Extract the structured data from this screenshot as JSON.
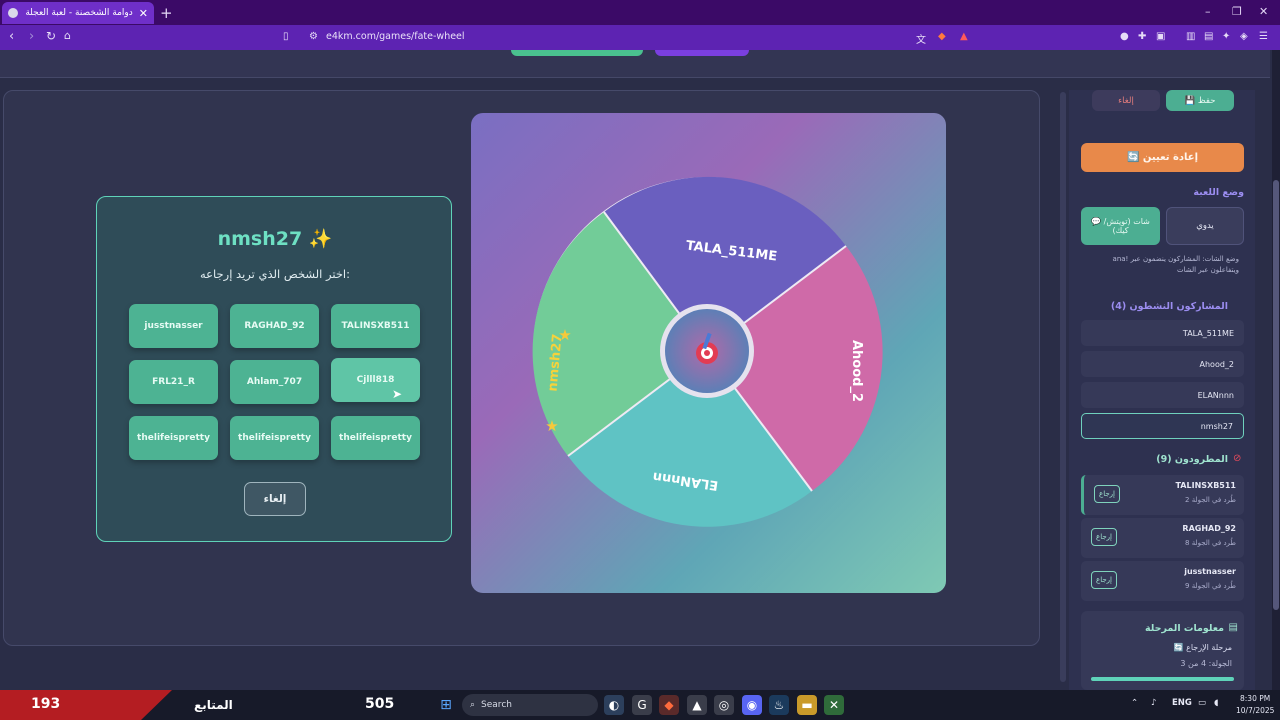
{
  "browser": {
    "tab_title": "دوامة الشخصنة - لعبة العجلة والد...",
    "tab_close": "✕",
    "new_tab": "+",
    "url": "e4km.com/games/fate-wheel",
    "window_controls": [
      "–",
      "❐",
      "✕"
    ]
  },
  "popup": {
    "title": "nmsh27 ✨",
    "subtitle": "اختر الشخص الذي تريد إرجاعه:",
    "players": [
      "jusstnasser",
      "RAGHAD_92",
      "TALINSXB511",
      "FRL21_R",
      "Ahlam_707",
      "Cjlll818",
      "thelifeispretty",
      "thelifeispretty",
      "thelifeispretty"
    ],
    "cancel": "إلغاء"
  },
  "wheel": {
    "center_icon": "target-icon",
    "segments": [
      {
        "name": "TALA_511ME",
        "color": "#6a5fbf"
      },
      {
        "name": "Ahood_2",
        "color": "#cf6aa8"
      },
      {
        "name": "ELANnnn",
        "color": "#5fc3c4"
      },
      {
        "name": "nmsh27",
        "color": "#72cc98"
      }
    ]
  },
  "sidebar": {
    "save": "💾 حفظ",
    "cancel": "إلغاء",
    "reset": "🔄 إعادة تعيين",
    "mode_title": "وضع اللعبة",
    "mode_manual": "يدوي",
    "mode_chat": "💬 شات (تويتش/كيك)",
    "mode_note": "وضع الشات: المشاركون ينضمون عبر !ana ويتفاعلون عبر الشات",
    "active_title": "المشاركون النشطون (4)",
    "active_players": [
      "TALA_511ME",
      "Ahood_2",
      "ELANnnn",
      "nmsh27"
    ],
    "eliminated_title": "المطرودون (9)",
    "eliminated": [
      {
        "name": "TALINSXB511",
        "round": "طُرد في الجولة 2",
        "action": "إرجاع"
      },
      {
        "name": "RAGHAD_92",
        "round": "طُرد في الجولة 8",
        "action": "إرجاع"
      },
      {
        "name": "jusstnasser",
        "round": "طُرد في الجولة 9",
        "action": "إرجاع"
      }
    ],
    "stage_title": "معلومات المرحلة",
    "stage_name": "🔄 مرحلة الإرجاع",
    "stage_round": "الجولة: 4 من 3"
  },
  "taskbar": {
    "score_left": "193",
    "label": "المتابع",
    "score_mid": "505",
    "search_placeholder": "Search",
    "lang": "ENG",
    "time": "8:30 PM",
    "date": "10/7/2025"
  },
  "colors": {
    "accent_teal": "#4db393",
    "accent_purple": "#9b8df0",
    "reset_orange": "#e8894a"
  }
}
